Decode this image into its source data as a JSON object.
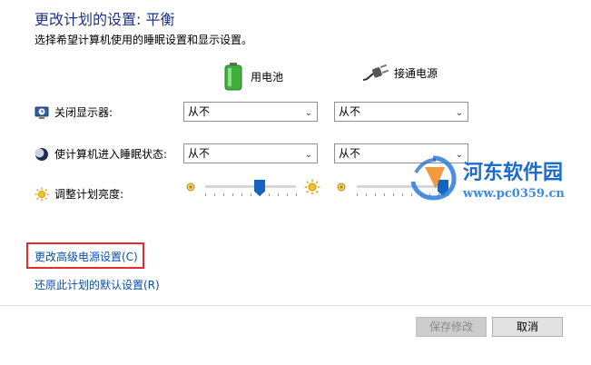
{
  "header": {
    "title": "更改计划的设置: 平衡",
    "subtitle": "选择希望计算机使用的睡眠设置和显示设置。"
  },
  "columns": {
    "battery": {
      "label": "用电池",
      "icon": "battery-icon"
    },
    "plugged": {
      "label": "接通电源",
      "icon": "power-plug-icon"
    }
  },
  "rows": {
    "display": {
      "label": "关闭显示器:",
      "icon": "monitor-clock-icon",
      "battery_value": "从不",
      "plugged_value": "从不"
    },
    "sleep": {
      "label": "使计算机进入睡眠状态:",
      "icon": "moon-icon",
      "battery_value": "从不",
      "plugged_value": "从不"
    },
    "brightness": {
      "label": "调整计划亮度:",
      "icon": "brightness-sun-icon",
      "battery_level": 0.6,
      "plugged_level": 0.95
    }
  },
  "links": {
    "advanced": "更改高级电源设置(C)",
    "restore": "还原此计划的默认设置(R)"
  },
  "buttons": {
    "save": "保存修改",
    "cancel": "取消"
  },
  "watermark": {
    "name": "河东软件园",
    "url": "www.pc0359.cn"
  },
  "colors": {
    "title": "#1e3287",
    "link": "#0a4fa8",
    "slider_thumb": "#1565c0",
    "highlight_box": "#e32c2c"
  }
}
